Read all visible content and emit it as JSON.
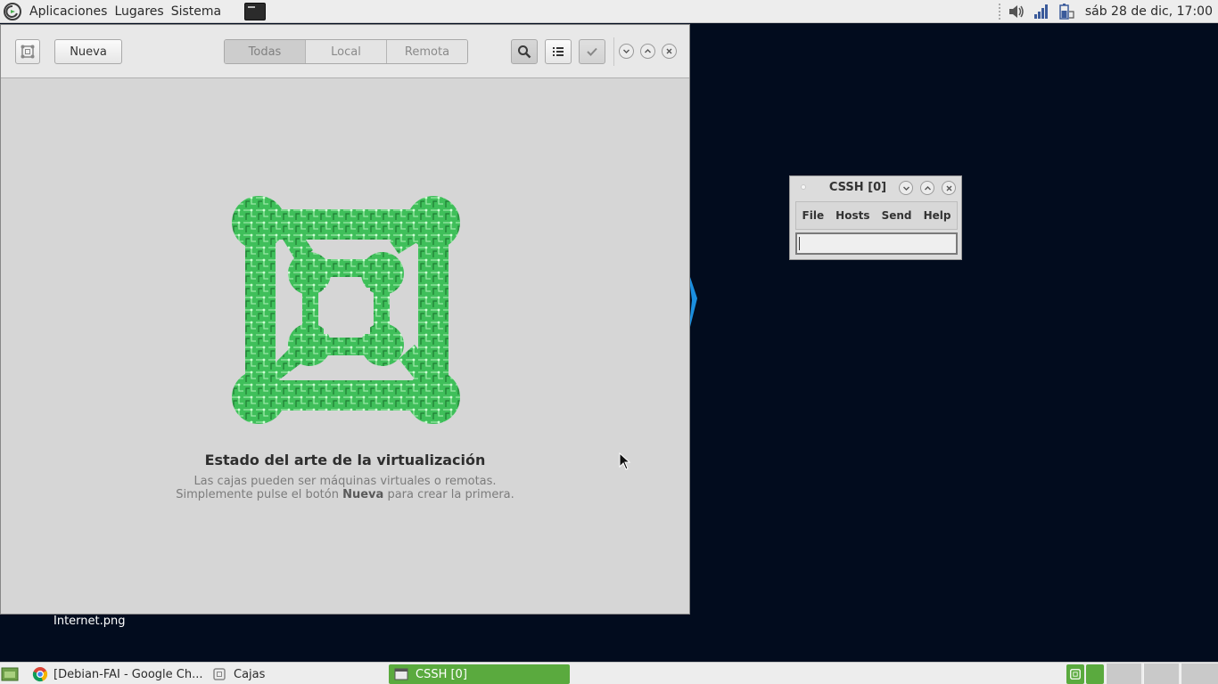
{
  "top_panel": {
    "menus": [
      "Aplicaciones",
      "Lugares",
      "Sistema"
    ],
    "clock": "sáb 28 de dic, 17:00"
  },
  "boxes_window": {
    "new_button": "Nueva",
    "filters": [
      "Todas",
      "Local",
      "Remota"
    ],
    "active_filter": "Todas",
    "empty_title": "Estado del arte de la virtualización",
    "empty_line1": "Las cajas pueden ser máquinas virtuales o remotas.",
    "empty_line2_pre": "Simplemente pulse el botón ",
    "empty_line2_bold": "Nueva",
    "empty_line2_post": " para crear la primera."
  },
  "cssh_window": {
    "title": "CSSH [0]",
    "menu": [
      "File",
      "Hosts",
      "Send",
      "Help"
    ],
    "input_value": ""
  },
  "desktop": {
    "icon_label": "Internet.png"
  },
  "taskbar": {
    "tasks": [
      "[Debian-FAI - Google Ch...",
      "Cajas",
      "CSSH [0]"
    ],
    "active_task": "CSSH [0]"
  },
  "colors": {
    "accent_green": "#5aaa3e",
    "logo_green": "#3fbf5a",
    "desktop_bg": "#020c1e"
  }
}
